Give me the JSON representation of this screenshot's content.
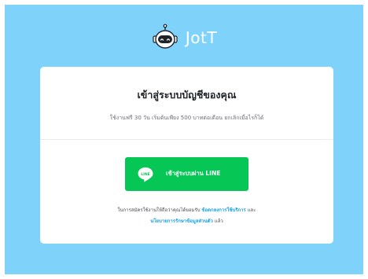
{
  "brand": {
    "name": "JotT",
    "logo_icon": "robot-head-icon"
  },
  "card": {
    "title": "เข้าสู่ระบบบัญชีของคุณ",
    "subtitle": "ใช้งานฟรี 30 วัน เริ่มต้นเพียง 500 บาทต่อเดือน ยกเลิกเมื่อไรก็ได้"
  },
  "line_button": {
    "label": "เข้าสู่ระบบผ่าน LINE",
    "icon_text": "LINE",
    "icon": "line-chat-bubble-icon"
  },
  "terms": {
    "prefix": "ในการสมัครใช้งานให้ถือว่าคุณได้ยอมรับ",
    "terms_link": "ข้อตกลงการใช้บริการ",
    "and": "และ",
    "privacy_link": "นโยบายการรักษาข้อมูลส่วนตัว",
    "suffix": "แล้ว"
  },
  "colors": {
    "background": "#7fd3fb",
    "card": "#ffffff",
    "line_green": "#06c755",
    "link": "#1aa3e8"
  }
}
